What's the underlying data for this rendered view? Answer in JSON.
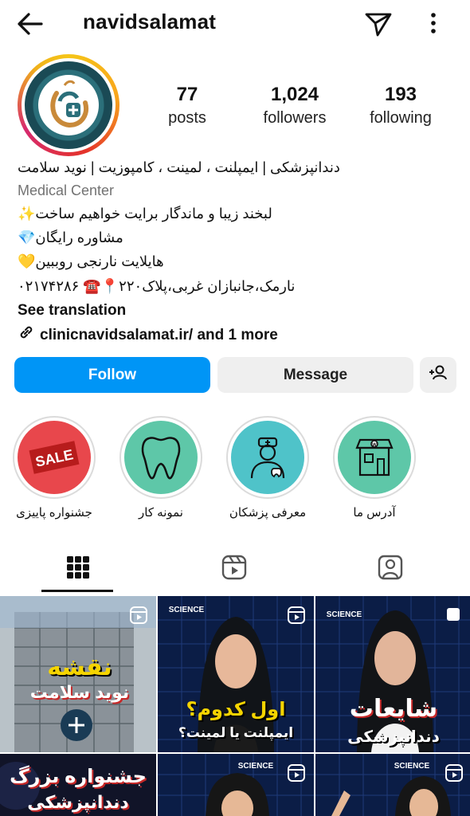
{
  "header": {
    "username": "navidsalamat"
  },
  "profile": {
    "stats": [
      {
        "value": "77",
        "label": "posts"
      },
      {
        "value": "1,024",
        "label": "followers"
      },
      {
        "value": "193",
        "label": "following"
      }
    ],
    "bio": {
      "line1": "دندانپزشکی | ایمپلنت ، لمینت ، کامپوزیت | نوید سلامت",
      "category": "Medical Center",
      "line2": "لبخند زیبا و ماندگار برایت خواهیم ساخت✨",
      "line3": "مشاوره رایگان💎",
      "line4": "هایلایت نارنجی روببین💛",
      "line5": "نارمک،جانبازان غربی،پلاک۲۲۰📍☎️ ۰۲۱۷۴۲۸۶",
      "see_translation": "See translation",
      "link": "clinicnavidsalamat.ir/ and 1 more"
    }
  },
  "actions": {
    "follow": "Follow",
    "message": "Message"
  },
  "highlights": [
    {
      "label": "جشنواره پاییزی",
      "color": "#e8474c"
    },
    {
      "label": "نمونه کار",
      "color": "#5ec7a8"
    },
    {
      "label": "معرفی پزشکان",
      "color": "#4fc3c9"
    },
    {
      "label": "آدرس ما",
      "color": "#5ec7a8"
    }
  ],
  "posts": [
    {
      "line1": "نقشه",
      "line2": "نوید سلامت"
    },
    {
      "line1": "اول کدوم؟",
      "line2": "ایمپلنت یا لمینت؟",
      "tag": "SCIENCE"
    },
    {
      "line1": "شایعات",
      "line2": "دندانپزشکی",
      "tag": "SCIENCE"
    },
    {
      "line1": "جشنواره بزرگ",
      "line2": "دندانپزشکی"
    },
    {
      "line1": "",
      "line2": "",
      "tag": "SCIENCE"
    },
    {
      "line1": "",
      "line2": "",
      "tag": "SCIENCE"
    }
  ],
  "colors": {
    "accent": "#0095f6",
    "post_bg": "#0a1a3f"
  }
}
